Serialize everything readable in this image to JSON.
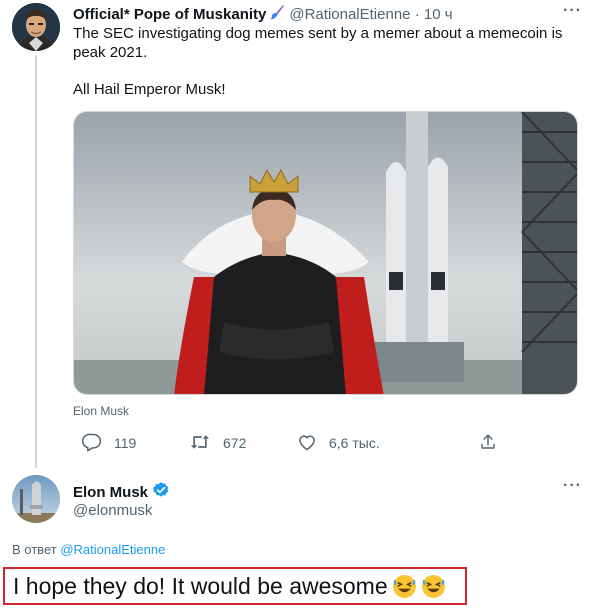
{
  "tweet": {
    "author_name": "Official* Pope of Muskanity",
    "author_handle": "@RationalEtienne",
    "separator": "·",
    "time": "10 ч",
    "more": "···",
    "line1": "The SEC investigating dog memes sent by a memer about a memecoin is peak 2021.",
    "line2": "All Hail Emperor Musk!",
    "media_caption": "Elon Musk",
    "replies": "119",
    "retweets": "672",
    "likes": "6,6 тыс."
  },
  "reply": {
    "author_name": "Elon Musk",
    "author_handle": "@elonmusk",
    "more": "···",
    "reply_to_prefix": "В ответ",
    "reply_to_handle": "@RationalEtienne",
    "text": "I hope they do! It would be awesome",
    "emojis": [
      "rofl-emoji",
      "rofl-emoji"
    ],
    "highlight_color": "#d0272e"
  },
  "colors": {
    "link": "#1d9bf0",
    "secondary_text": "#536471",
    "verified": "#1d9bf0",
    "thread_line": "#cfd9de"
  }
}
